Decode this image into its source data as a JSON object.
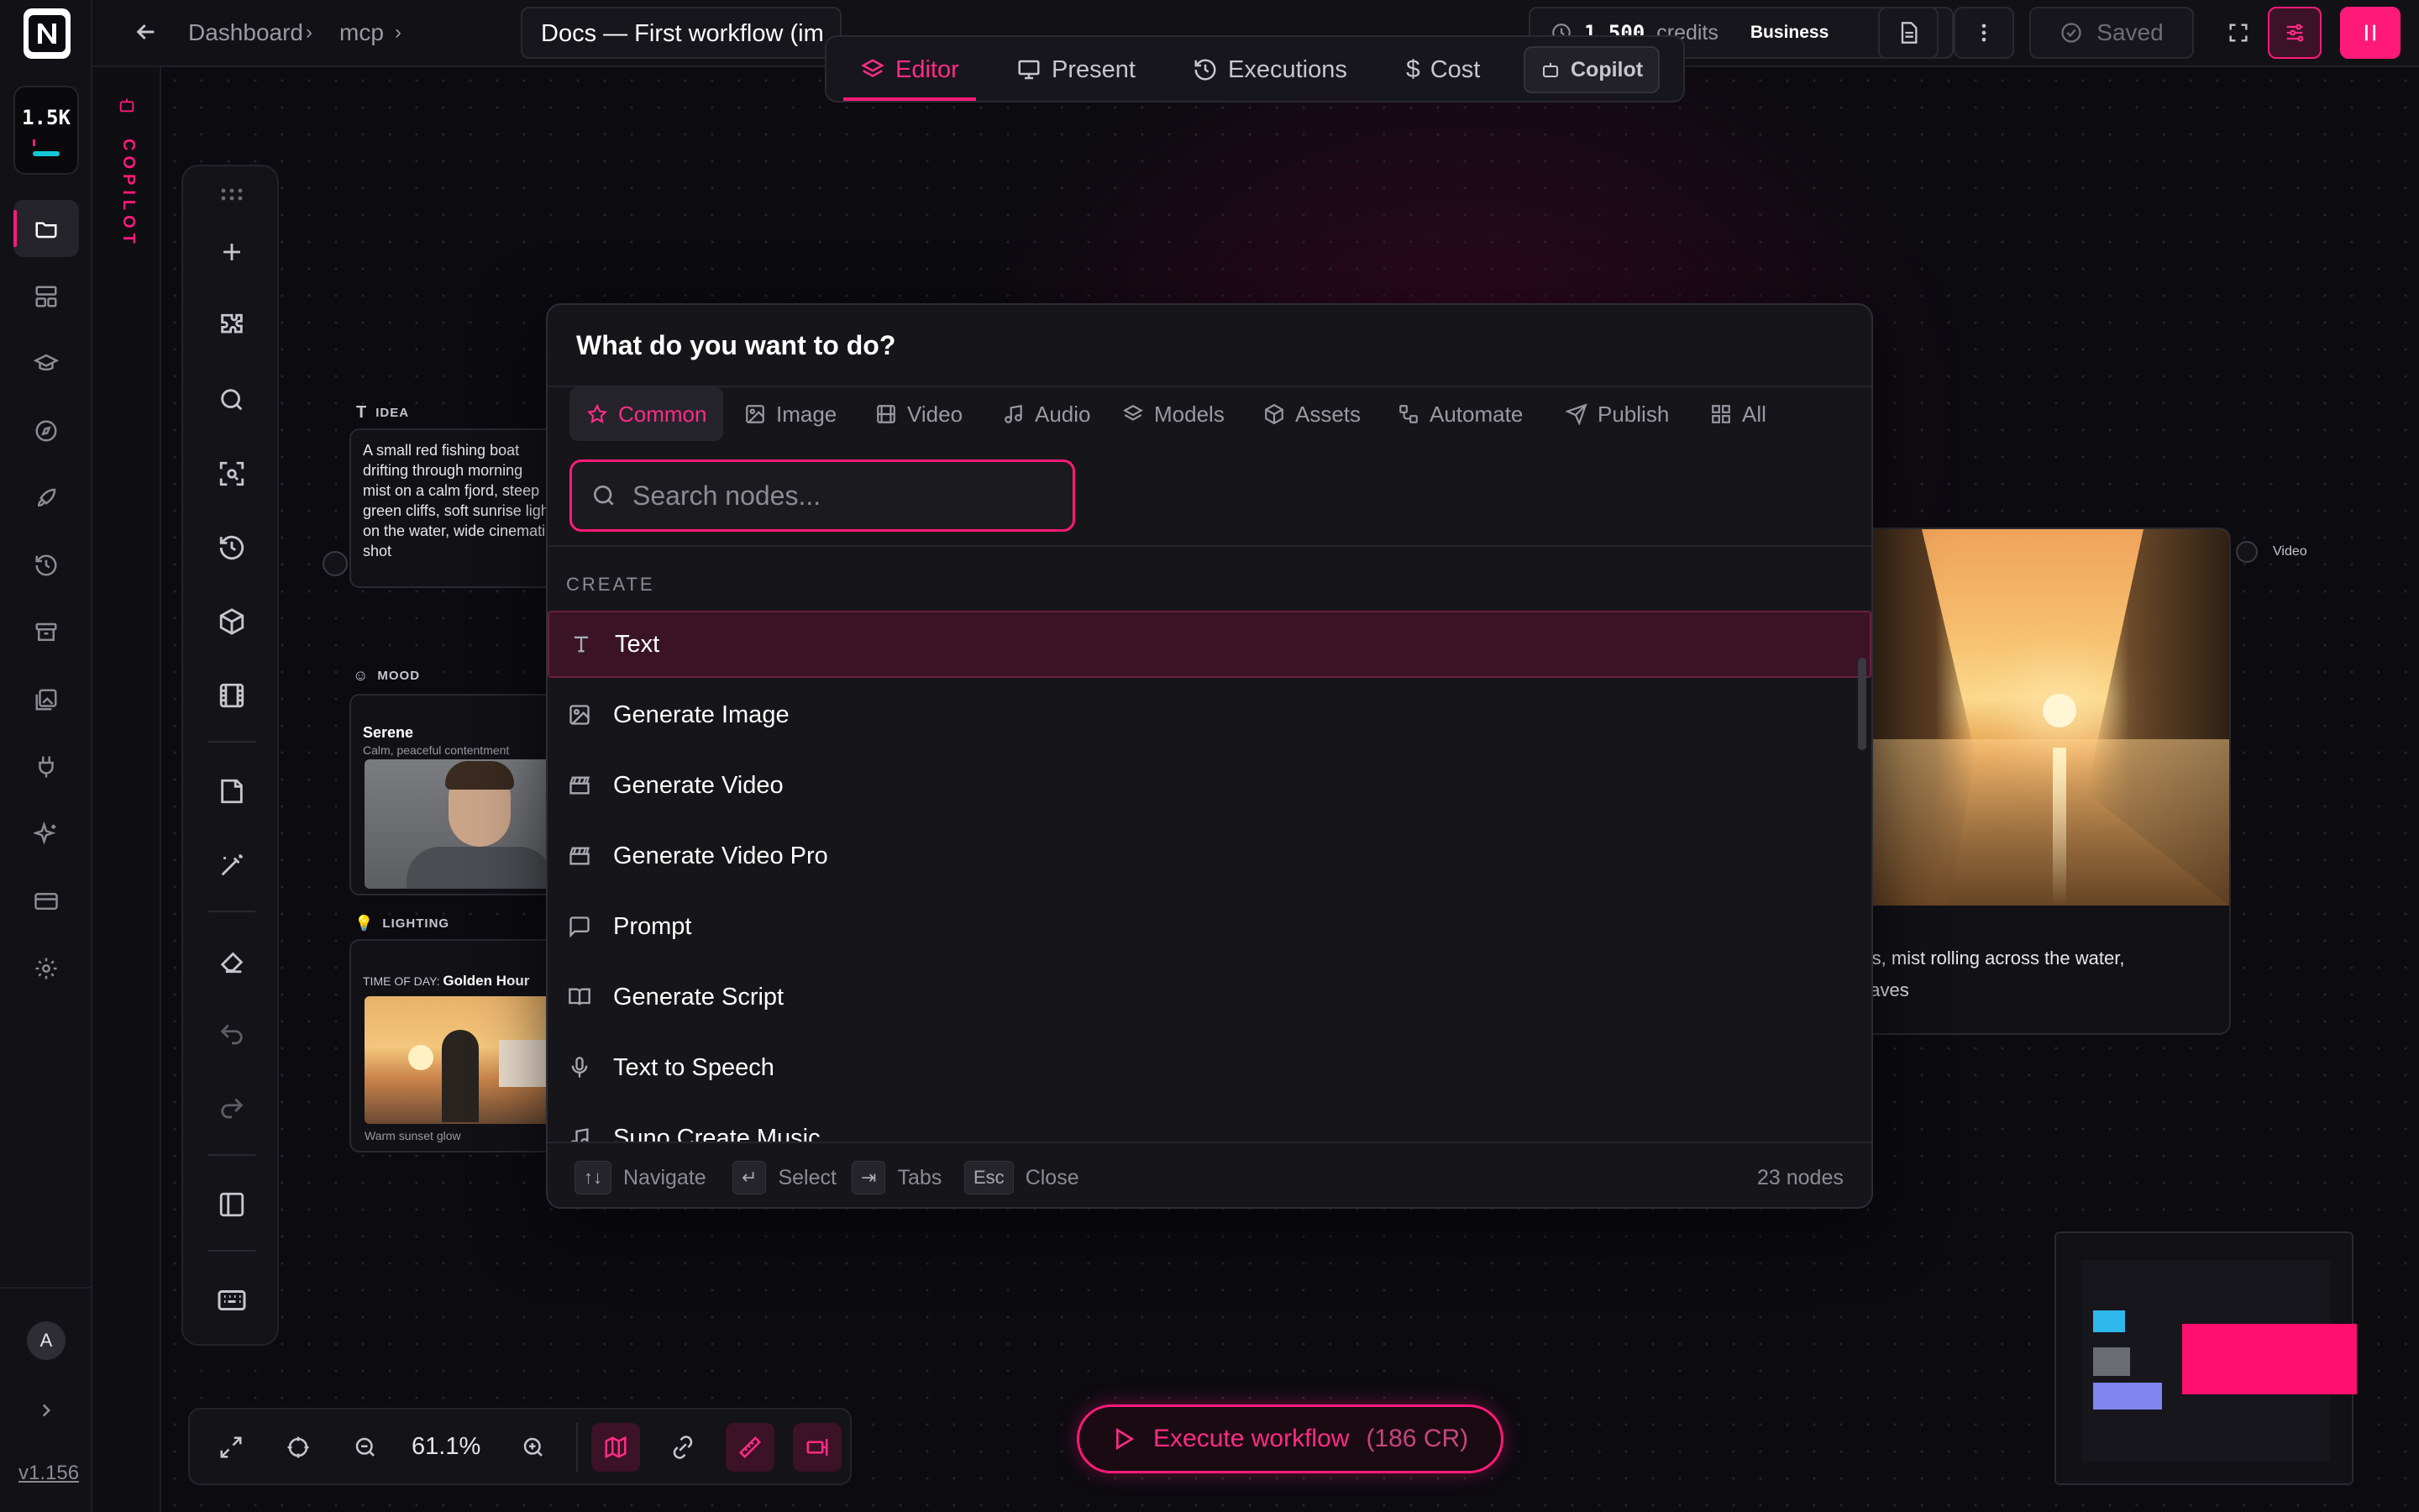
{
  "app": {
    "version": "v1.156",
    "avatar_initial": "A",
    "credits_short": "1.5K"
  },
  "sidebar": {
    "copilot_label": "COPILOT"
  },
  "breadcrumb": {
    "items": [
      "Dashboard",
      "mcp"
    ],
    "current": "Docs — First workflow (im"
  },
  "modes": {
    "editor": "Editor",
    "present": "Present",
    "executions": "Executions",
    "cost": "Cost",
    "copilot": "Copilot"
  },
  "topbar": {
    "credits_value": "1,500",
    "credits_label": "credits",
    "plan": "Business",
    "saved": "Saved"
  },
  "nodes": {
    "idea": {
      "label": "IDEA",
      "text": "A small red fishing boat drifting through morning mist on a calm fjord, steep green cliffs, soft sunrise light on the water, wide cinematic shot"
    },
    "mood": {
      "label": "MOOD",
      "title": "Serene",
      "subtitle": "Calm, peaceful contentment"
    },
    "lighting": {
      "label": "LIGHTING",
      "prefix": "TIME OF DAY:",
      "value": "Golden Hour",
      "caption": "Warm sunset glow"
    },
    "video": {
      "label": "Video",
      "desc_line1": "drifts, mist rolling across the water,",
      "desc_line2": "g waves"
    }
  },
  "palette": {
    "title": "What do you want to do?",
    "categories": [
      "Common",
      "Image",
      "Video",
      "Audio",
      "Models",
      "Assets",
      "Automate",
      "Publish",
      "All"
    ],
    "search_placeholder": "Search nodes...",
    "section": "CREATE",
    "items": [
      "Text",
      "Generate Image",
      "Generate Video",
      "Generate Video Pro",
      "Prompt",
      "Generate Script",
      "Text to Speech",
      "Suno Create Music"
    ],
    "footer": {
      "navigate": "Navigate",
      "select": "Select",
      "tabs": "Tabs",
      "esc_key": "Esc",
      "close": "Close",
      "count": "23 nodes"
    }
  },
  "bottom": {
    "zoom": "61.1%",
    "execute_label": "Execute workflow",
    "execute_cost": "(186 CR)"
  },
  "colors": {
    "accent": "#ff1a7a",
    "bg": "#0c0b10",
    "panel": "#161519"
  }
}
